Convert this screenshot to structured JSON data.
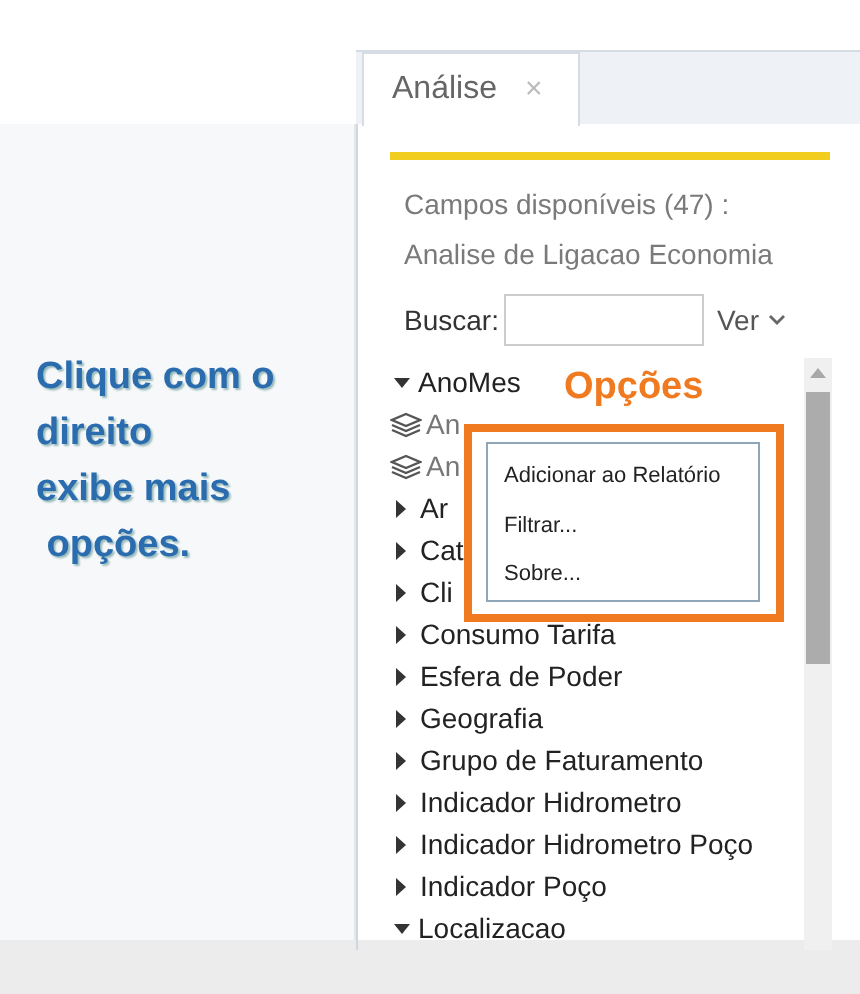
{
  "callout": {
    "lines": [
      "Clique com o",
      "direito",
      "exibe mais",
      " opções."
    ]
  },
  "tabs": [
    {
      "label": "Análise",
      "close": "×",
      "selected": true
    }
  ],
  "fields_panel": {
    "heading": "Campos disponíveis (47) :",
    "subheading": "Analise de Ligacao Economia",
    "search": {
      "label": "Buscar:"
    },
    "view_menu": "Ver",
    "tree": [
      {
        "kind": "folder",
        "label": "AnoMes",
        "expanded": true,
        "children": [
          {
            "kind": "field",
            "label": "An"
          },
          {
            "kind": "field",
            "label": "An"
          }
        ]
      },
      {
        "kind": "folder",
        "label": "Ar",
        "expanded": false
      },
      {
        "kind": "folder",
        "label": "Cat",
        "expanded": false
      },
      {
        "kind": "folder",
        "label": "Cli",
        "expanded": false
      },
      {
        "kind": "folder",
        "label": "Consumo Tarifa",
        "expanded": false
      },
      {
        "kind": "folder",
        "label": "Esfera de Poder",
        "expanded": false
      },
      {
        "kind": "folder",
        "label": "Geografia",
        "expanded": false
      },
      {
        "kind": "folder",
        "label": "Grupo de Faturamento",
        "expanded": false
      },
      {
        "kind": "folder",
        "label": "Indicador Hidrometro",
        "expanded": false
      },
      {
        "kind": "folder",
        "label": "Indicador Hidrometro Poço",
        "expanded": false
      },
      {
        "kind": "folder",
        "label": "Indicador Poço",
        "expanded": false
      },
      {
        "kind": "folder",
        "label": "Localizacao",
        "expanded": true
      }
    ]
  },
  "annotation": {
    "label": "Opções"
  },
  "context_menu": {
    "items": [
      "Adicionar ao Relatório",
      "Filtrar...",
      "Sobre..."
    ]
  }
}
